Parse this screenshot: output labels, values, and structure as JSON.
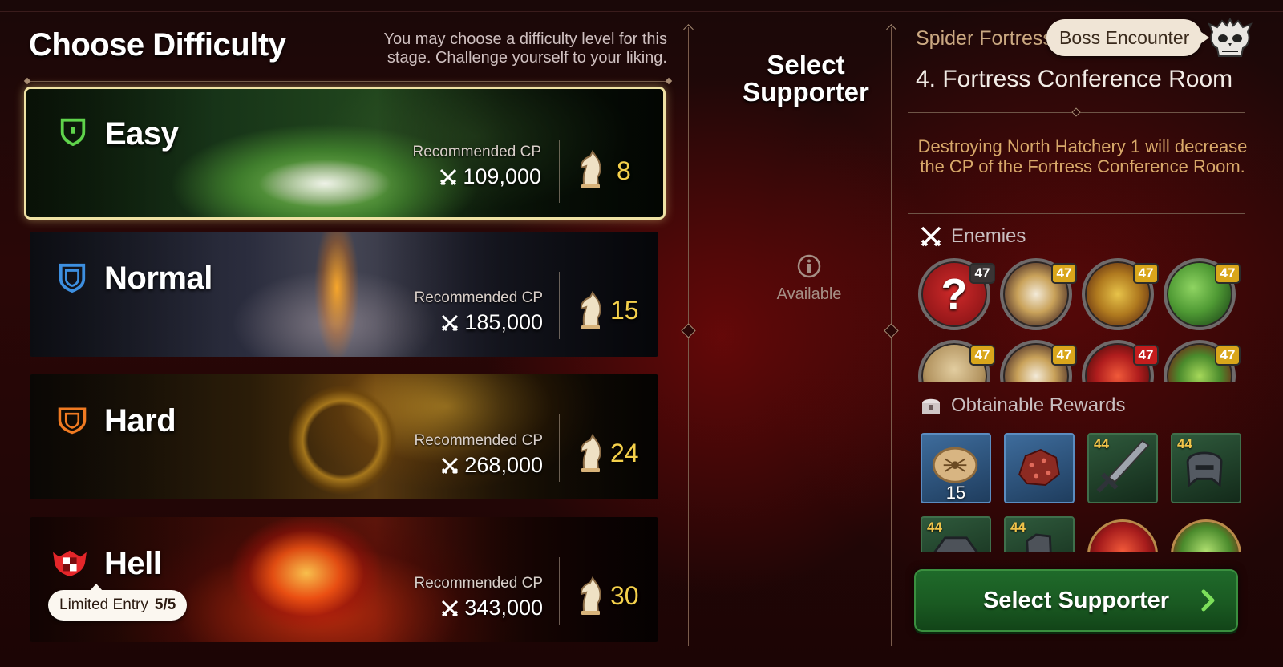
{
  "header": {
    "title": "Choose Difficulty",
    "subtitle": "You may choose a difficulty level for this stage. Challenge yourself to your liking."
  },
  "difficulties": [
    {
      "name": "Easy",
      "recommended_label": "Recommended CP",
      "cp": "109,000",
      "stamina": "8",
      "shield_color": "#5fd34b",
      "selected": true
    },
    {
      "name": "Normal",
      "recommended_label": "Recommended CP",
      "cp": "185,000",
      "stamina": "15",
      "shield_color": "#3d8fe0",
      "selected": false
    },
    {
      "name": "Hard",
      "recommended_label": "Recommended CP",
      "cp": "268,000",
      "stamina": "24",
      "shield_color": "#f07a22",
      "selected": false
    },
    {
      "name": "Hell",
      "recommended_label": "Recommended CP",
      "cp": "343,000",
      "stamina": "30",
      "shield_color": "#e5262a",
      "selected": false,
      "limited_label": "Limited Entry",
      "limited_count": "5/5"
    }
  ],
  "supporter": {
    "title": "Select Supporter",
    "status": "Available"
  },
  "stage": {
    "group": "Spider Fortress",
    "boss_label": "Boss Encounter",
    "name": "4. Fortress Conference Room",
    "description": "Destroying North Hatchery 1 will decrease the CP of the Fortress Conference Room."
  },
  "enemies": {
    "title": "Enemies",
    "items": [
      {
        "icon": "unknown-boss-icon",
        "level": "47",
        "badge": "dark"
      },
      {
        "icon": "horned-beast-icon",
        "level": "47",
        "badge": "yellow"
      },
      {
        "icon": "golden-dragon-icon",
        "level": "47",
        "badge": "yellow"
      },
      {
        "icon": "green-egg-sac-icon",
        "level": "47",
        "badge": "yellow"
      },
      {
        "icon": "stone-shell-icon",
        "level": "47",
        "badge": "yellow"
      },
      {
        "icon": "horned-beast-icon",
        "level": "47",
        "badge": "yellow"
      },
      {
        "icon": "red-spider-icon",
        "level": "47",
        "badge": "red"
      },
      {
        "icon": "green-mantis-icon",
        "level": "47",
        "badge": "yellow"
      }
    ]
  },
  "rewards": {
    "title": "Obtainable Rewards",
    "items": [
      {
        "icon": "spider-coin-icon",
        "qty": "15",
        "level": ""
      },
      {
        "icon": "red-ore-icon",
        "qty": "",
        "level": ""
      },
      {
        "icon": "sword-icon",
        "qty": "",
        "level": "44"
      },
      {
        "icon": "helmet-icon",
        "qty": "",
        "level": "44"
      },
      {
        "icon": "armor-icon",
        "qty": "",
        "level": "44"
      },
      {
        "icon": "gauntlet-icon",
        "qty": "",
        "level": "44"
      },
      {
        "icon": "red-core-icon",
        "qty": "",
        "level": ""
      },
      {
        "icon": "green-core-icon",
        "qty": "",
        "level": ""
      }
    ]
  },
  "cta": {
    "label": "Select Supporter"
  }
}
